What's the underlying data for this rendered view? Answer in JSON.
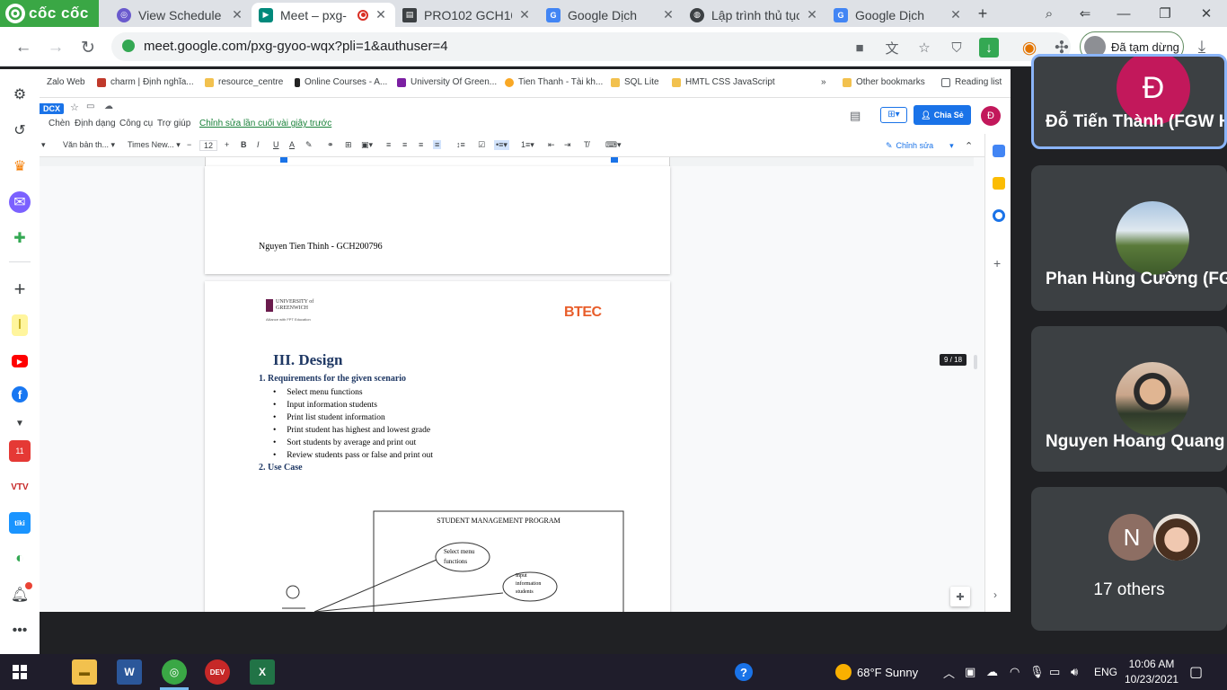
{
  "browser": {
    "brand": "cốc cốc",
    "tabs": [
      {
        "title": "View Schedule",
        "close": "✕"
      },
      {
        "title": "Meet – pxg-",
        "close": "✕"
      },
      {
        "title": "PRO102 GCH10",
        "close": "✕"
      },
      {
        "title": "Google Dịch",
        "close": "✕"
      },
      {
        "title": "Lập trình thủ tục",
        "close": "✕"
      },
      {
        "title": "Google Dịch",
        "close": "✕"
      }
    ],
    "new_tab": "+",
    "url": "meet.google.com/pxg-gyoo-wqx?pli=1&authuser=4",
    "profile_status": "Đã tạm dừng"
  },
  "shared_screen": {
    "bookmarks": [
      "Zalo Web",
      "charm | Định nghĩa...",
      "resource_centre",
      "Online Courses - A...",
      "University Of Green...",
      "Tien Thanh - Tài kh...",
      "SQL Lite",
      "HMTL CSS JavaScript"
    ],
    "bookmarks_more": "»",
    "other_bookmarks": "Other bookmarks",
    "reading_list": "Reading list",
    "doc_badge": "DCX",
    "doc_menus": [
      "Chèn",
      "Định dạng",
      "Công cụ",
      "Trợ giúp"
    ],
    "last_edit": "Chỉnh sửa lần cuối vài giây trước",
    "share_button": "Chia Sẻ",
    "user_initial": "Đ",
    "toolbar": {
      "style": "Văn bản th...",
      "font": "Times New...",
      "size": "12",
      "edit_mode": "Chỉnh sửa"
    },
    "page_counter": "9 / 18",
    "doc": {
      "author_footer": "Nguyen Tien Thinh - GCH200796",
      "logo_university": "UNIVERSITY of GREENWICH",
      "logo_alliance": "Alliance with FPT Education",
      "logo_btec": "BTEC",
      "section_title": "III. Design",
      "req_heading": "1.   Requirements for the given scenario",
      "requirements": [
        "Select menu functions",
        "Input information students",
        "Print list student information",
        "Print student has highest and lowest grade",
        "Sort students by average and print out",
        "Review students pass or false and print out"
      ],
      "usecase_heading": "2.   Use Case",
      "diagram_title": "STUDENT MANAGEMENT PROGRAM",
      "usecase_1": "Select menu functions",
      "usecase_2": "Input information students"
    }
  },
  "participants": [
    {
      "name": "Đỗ Tiến Thành (FGW H",
      "initial": "Đ",
      "color": "#c2185b"
    },
    {
      "name": "Phan Hùng Cường (FG"
    },
    {
      "name": "Nguyen Hoang Quang"
    },
    {
      "others_label": "17 others",
      "initial": "N"
    }
  ],
  "taskbar": {
    "weather": "68°F  Sunny",
    "language": "ENG",
    "time": "10:06 AM",
    "date": "10/23/2021"
  }
}
